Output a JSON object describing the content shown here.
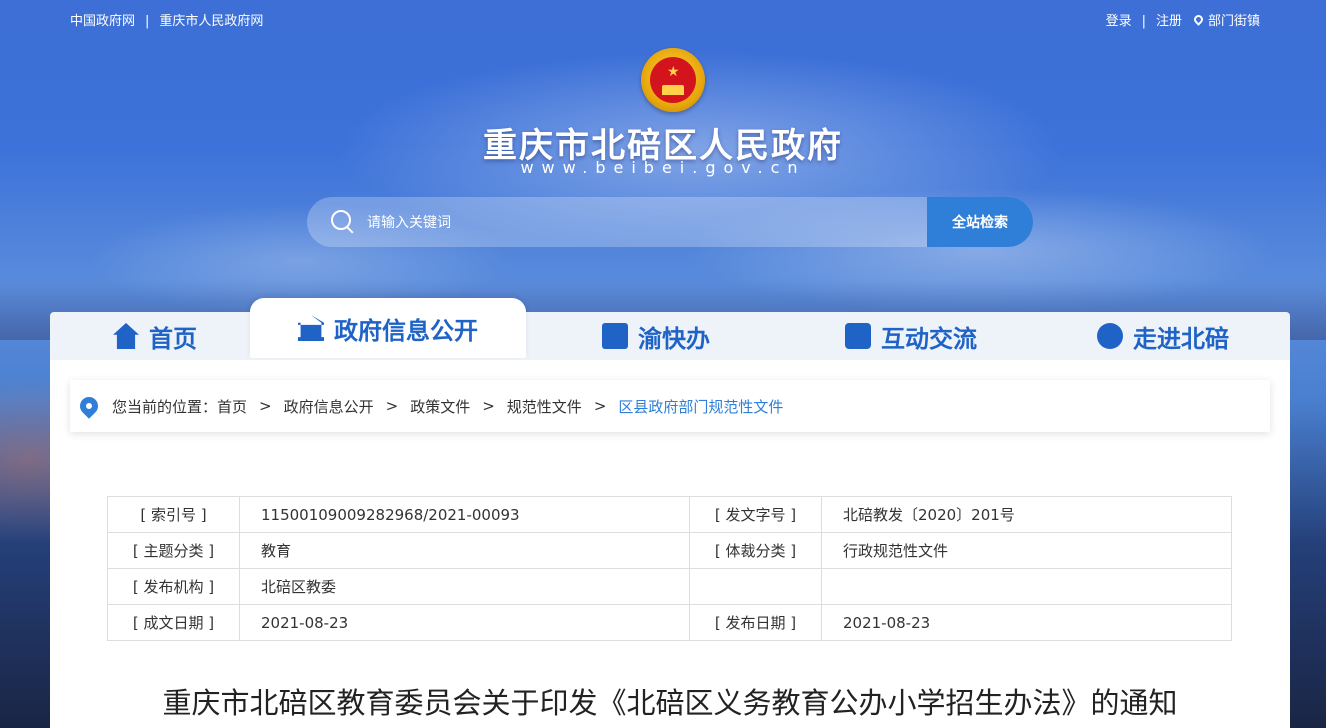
{
  "topbar": {
    "links_left": [
      "中国政府网",
      "重庆市人民政府网"
    ],
    "login": "登录",
    "register": "注册",
    "dept": "部门街镇"
  },
  "header": {
    "title": "重庆市北碚区人民政府",
    "url": "www.beibei.gov.cn"
  },
  "search": {
    "placeholder": "请输入关键词",
    "button": "全站检索"
  },
  "nav": {
    "items": [
      {
        "label": "首页",
        "icon": "home-icon"
      },
      {
        "label": "政府信息公开",
        "icon": "government-building-icon"
      },
      {
        "label": "渝快办",
        "icon": "clipboard-icon"
      },
      {
        "label": "互动交流",
        "icon": "chat-icon"
      },
      {
        "label": "走进北碚",
        "icon": "compass-icon"
      }
    ],
    "active": "政府信息公开"
  },
  "breadcrumb": {
    "prefix": "您当前的位置：",
    "items": [
      "首页",
      "政府信息公开",
      "政策文件",
      "规范性文件",
      "区县政府部门规范性文件"
    ],
    "separator": ">"
  },
  "meta": {
    "index_label": "[ 索引号 ]",
    "index_value": "11500109009282968/2021-00093",
    "docno_label": "[ 发文字号 ]",
    "docno_value": "北碚教发〔2020〕201号",
    "topic_label": "[ 主题分类 ]",
    "topic_value": "教育",
    "genre_label": "[ 体裁分类 ]",
    "genre_value": "行政规范性文件",
    "org_label": "[ 发布机构 ]",
    "org_value": "北碚区教委",
    "created_label": "[ 成文日期 ]",
    "created_value": "2021-08-23",
    "published_label": "[ 发布日期 ]",
    "published_value": "2021-08-23"
  },
  "document": {
    "title": "重庆市北碚区教育委员会关于印发《北碚区义务教育公办小学招生办法》的通知"
  },
  "colors": {
    "accent": "#2f7fd8",
    "nav_text": "#1f63c6"
  }
}
